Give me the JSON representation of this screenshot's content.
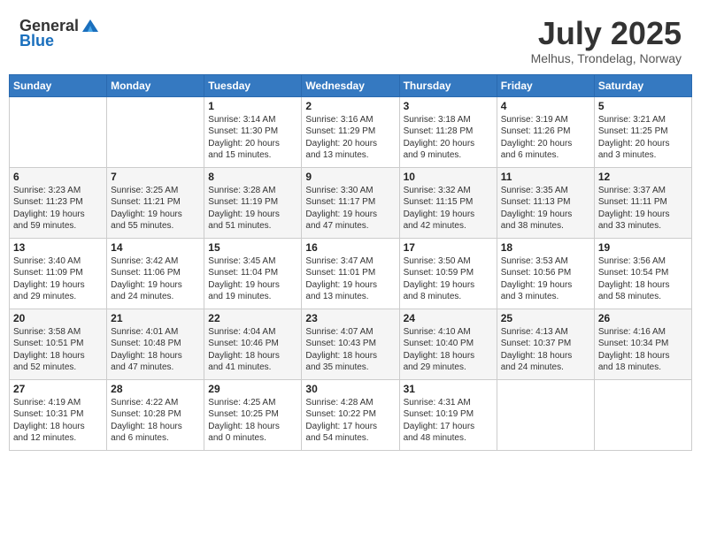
{
  "header": {
    "logo": {
      "text_general": "General",
      "text_blue": "Blue"
    },
    "title": "July 2025",
    "location": "Melhus, Trondelag, Norway"
  },
  "calendar": {
    "days_of_week": [
      "Sunday",
      "Monday",
      "Tuesday",
      "Wednesday",
      "Thursday",
      "Friday",
      "Saturday"
    ],
    "weeks": [
      [
        {
          "day": "",
          "info": ""
        },
        {
          "day": "",
          "info": ""
        },
        {
          "day": "1",
          "info": "Sunrise: 3:14 AM\nSunset: 11:30 PM\nDaylight: 20 hours\nand 15 minutes."
        },
        {
          "day": "2",
          "info": "Sunrise: 3:16 AM\nSunset: 11:29 PM\nDaylight: 20 hours\nand 13 minutes."
        },
        {
          "day": "3",
          "info": "Sunrise: 3:18 AM\nSunset: 11:28 PM\nDaylight: 20 hours\nand 9 minutes."
        },
        {
          "day": "4",
          "info": "Sunrise: 3:19 AM\nSunset: 11:26 PM\nDaylight: 20 hours\nand 6 minutes."
        },
        {
          "day": "5",
          "info": "Sunrise: 3:21 AM\nSunset: 11:25 PM\nDaylight: 20 hours\nand 3 minutes."
        }
      ],
      [
        {
          "day": "6",
          "info": "Sunrise: 3:23 AM\nSunset: 11:23 PM\nDaylight: 19 hours\nand 59 minutes."
        },
        {
          "day": "7",
          "info": "Sunrise: 3:25 AM\nSunset: 11:21 PM\nDaylight: 19 hours\nand 55 minutes."
        },
        {
          "day": "8",
          "info": "Sunrise: 3:28 AM\nSunset: 11:19 PM\nDaylight: 19 hours\nand 51 minutes."
        },
        {
          "day": "9",
          "info": "Sunrise: 3:30 AM\nSunset: 11:17 PM\nDaylight: 19 hours\nand 47 minutes."
        },
        {
          "day": "10",
          "info": "Sunrise: 3:32 AM\nSunset: 11:15 PM\nDaylight: 19 hours\nand 42 minutes."
        },
        {
          "day": "11",
          "info": "Sunrise: 3:35 AM\nSunset: 11:13 PM\nDaylight: 19 hours\nand 38 minutes."
        },
        {
          "day": "12",
          "info": "Sunrise: 3:37 AM\nSunset: 11:11 PM\nDaylight: 19 hours\nand 33 minutes."
        }
      ],
      [
        {
          "day": "13",
          "info": "Sunrise: 3:40 AM\nSunset: 11:09 PM\nDaylight: 19 hours\nand 29 minutes."
        },
        {
          "day": "14",
          "info": "Sunrise: 3:42 AM\nSunset: 11:06 PM\nDaylight: 19 hours\nand 24 minutes."
        },
        {
          "day": "15",
          "info": "Sunrise: 3:45 AM\nSunset: 11:04 PM\nDaylight: 19 hours\nand 19 minutes."
        },
        {
          "day": "16",
          "info": "Sunrise: 3:47 AM\nSunset: 11:01 PM\nDaylight: 19 hours\nand 13 minutes."
        },
        {
          "day": "17",
          "info": "Sunrise: 3:50 AM\nSunset: 10:59 PM\nDaylight: 19 hours\nand 8 minutes."
        },
        {
          "day": "18",
          "info": "Sunrise: 3:53 AM\nSunset: 10:56 PM\nDaylight: 19 hours\nand 3 minutes."
        },
        {
          "day": "19",
          "info": "Sunrise: 3:56 AM\nSunset: 10:54 PM\nDaylight: 18 hours\nand 58 minutes."
        }
      ],
      [
        {
          "day": "20",
          "info": "Sunrise: 3:58 AM\nSunset: 10:51 PM\nDaylight: 18 hours\nand 52 minutes."
        },
        {
          "day": "21",
          "info": "Sunrise: 4:01 AM\nSunset: 10:48 PM\nDaylight: 18 hours\nand 47 minutes."
        },
        {
          "day": "22",
          "info": "Sunrise: 4:04 AM\nSunset: 10:46 PM\nDaylight: 18 hours\nand 41 minutes."
        },
        {
          "day": "23",
          "info": "Sunrise: 4:07 AM\nSunset: 10:43 PM\nDaylight: 18 hours\nand 35 minutes."
        },
        {
          "day": "24",
          "info": "Sunrise: 4:10 AM\nSunset: 10:40 PM\nDaylight: 18 hours\nand 29 minutes."
        },
        {
          "day": "25",
          "info": "Sunrise: 4:13 AM\nSunset: 10:37 PM\nDaylight: 18 hours\nand 24 minutes."
        },
        {
          "day": "26",
          "info": "Sunrise: 4:16 AM\nSunset: 10:34 PM\nDaylight: 18 hours\nand 18 minutes."
        }
      ],
      [
        {
          "day": "27",
          "info": "Sunrise: 4:19 AM\nSunset: 10:31 PM\nDaylight: 18 hours\nand 12 minutes."
        },
        {
          "day": "28",
          "info": "Sunrise: 4:22 AM\nSunset: 10:28 PM\nDaylight: 18 hours\nand 6 minutes."
        },
        {
          "day": "29",
          "info": "Sunrise: 4:25 AM\nSunset: 10:25 PM\nDaylight: 18 hours\nand 0 minutes."
        },
        {
          "day": "30",
          "info": "Sunrise: 4:28 AM\nSunset: 10:22 PM\nDaylight: 17 hours\nand 54 minutes."
        },
        {
          "day": "31",
          "info": "Sunrise: 4:31 AM\nSunset: 10:19 PM\nDaylight: 17 hours\nand 48 minutes."
        },
        {
          "day": "",
          "info": ""
        },
        {
          "day": "",
          "info": ""
        }
      ]
    ]
  }
}
